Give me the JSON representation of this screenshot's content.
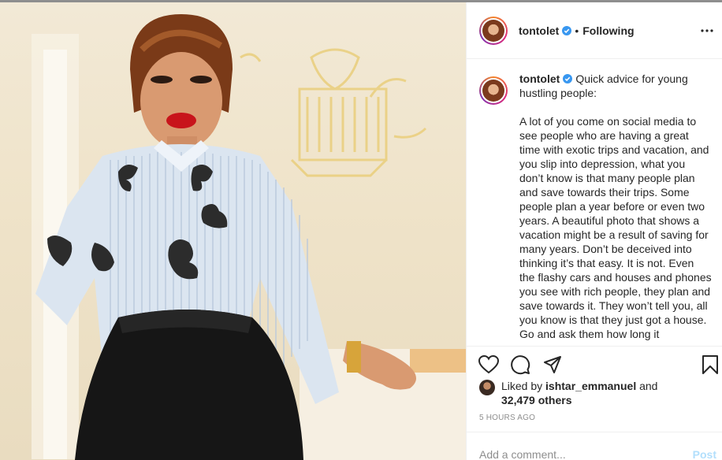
{
  "header": {
    "username": "tontolet",
    "separator": "•",
    "follow_state": "Following",
    "more_icon": "more-horizontal-icon"
  },
  "caption": {
    "username": "tontolet",
    "text": "Quick advice for young hustling people:\n\nA lot of you come on social media to see people who are having a great time with exotic trips and vacation, and you slip into depression, what you don’t know is that many people plan and save towards their trips. Some people plan a year before or even two years. A beautiful photo that shows a vacation might be a result of saving for many years. Don’t be deceived into thinking it’s that easy. It is not. Even the flashy cars and houses and phones you see with rich people, they plan and save towards it. They won’t tell you, all you know is that they just got a house. Go and ask them how long it"
  },
  "actions": {
    "like_icon": "heart-icon",
    "comment_icon": "comment-icon",
    "share_icon": "share-icon",
    "save_icon": "bookmark-icon"
  },
  "likes": {
    "prefix": "Liked by",
    "user": "ishtar_emmanuel",
    "middle": "and",
    "count": "32,479 others"
  },
  "timestamp": "5 HOURS AGO",
  "comment": {
    "placeholder": "Add a comment...",
    "post_label": "Post"
  },
  "colors": {
    "verified": "#3897f0",
    "post_disabled": "#b2dffc",
    "muted": "#8e8e8e",
    "text": "#262626"
  }
}
